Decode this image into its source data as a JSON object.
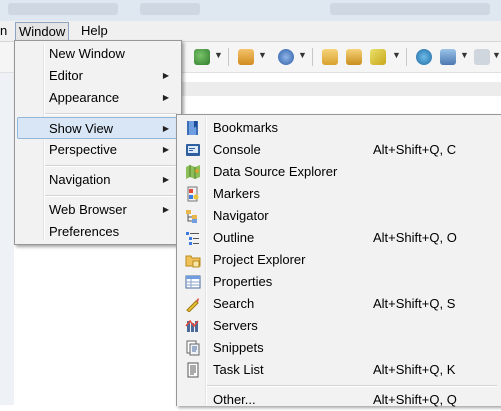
{
  "menubar": {
    "partial_label": "n",
    "window_label": "Window",
    "help_label": "Help"
  },
  "window_menu": {
    "items": [
      {
        "label": "New Window"
      },
      {
        "label": "Editor",
        "submenu": true
      },
      {
        "label": "Appearance",
        "submenu": true
      },
      {
        "label": "Show View",
        "submenu": true,
        "selected": true
      },
      {
        "label": "Perspective",
        "submenu": true
      },
      {
        "label": "Navigation",
        "submenu": true
      },
      {
        "label": "Web Browser",
        "submenu": true
      },
      {
        "label": "Preferences"
      }
    ]
  },
  "show_view_menu": {
    "items": [
      {
        "label": "Bookmarks",
        "shortcut": "",
        "icon": "bookmarks-icon"
      },
      {
        "label": "Console",
        "shortcut": "Alt+Shift+Q, C",
        "icon": "console-icon"
      },
      {
        "label": "Data Source Explorer",
        "shortcut": "",
        "icon": "data-source-explorer-icon"
      },
      {
        "label": "Markers",
        "shortcut": "",
        "icon": "markers-icon"
      },
      {
        "label": "Navigator",
        "shortcut": "",
        "icon": "navigator-icon"
      },
      {
        "label": "Outline",
        "shortcut": "Alt+Shift+Q, O",
        "icon": "outline-icon"
      },
      {
        "label": "Project Explorer",
        "shortcut": "",
        "icon": "project-explorer-icon"
      },
      {
        "label": "Properties",
        "shortcut": "",
        "icon": "properties-icon"
      },
      {
        "label": "Search",
        "shortcut": "Alt+Shift+Q, S",
        "icon": "search-icon"
      },
      {
        "label": "Servers",
        "shortcut": "",
        "icon": "servers-icon"
      },
      {
        "label": "Snippets",
        "shortcut": "",
        "icon": "snippets-icon"
      },
      {
        "label": "Task List",
        "shortcut": "Alt+Shift+Q, K",
        "icon": "task-list-icon"
      },
      {
        "label": "Other...",
        "shortcut": "Alt+Shift+Q, Q",
        "icon": ""
      }
    ]
  },
  "colors": {
    "menu_bg": "#f2f2f2",
    "selection_bg": "#d8e6f6",
    "selection_border": "#93b7dc"
  }
}
